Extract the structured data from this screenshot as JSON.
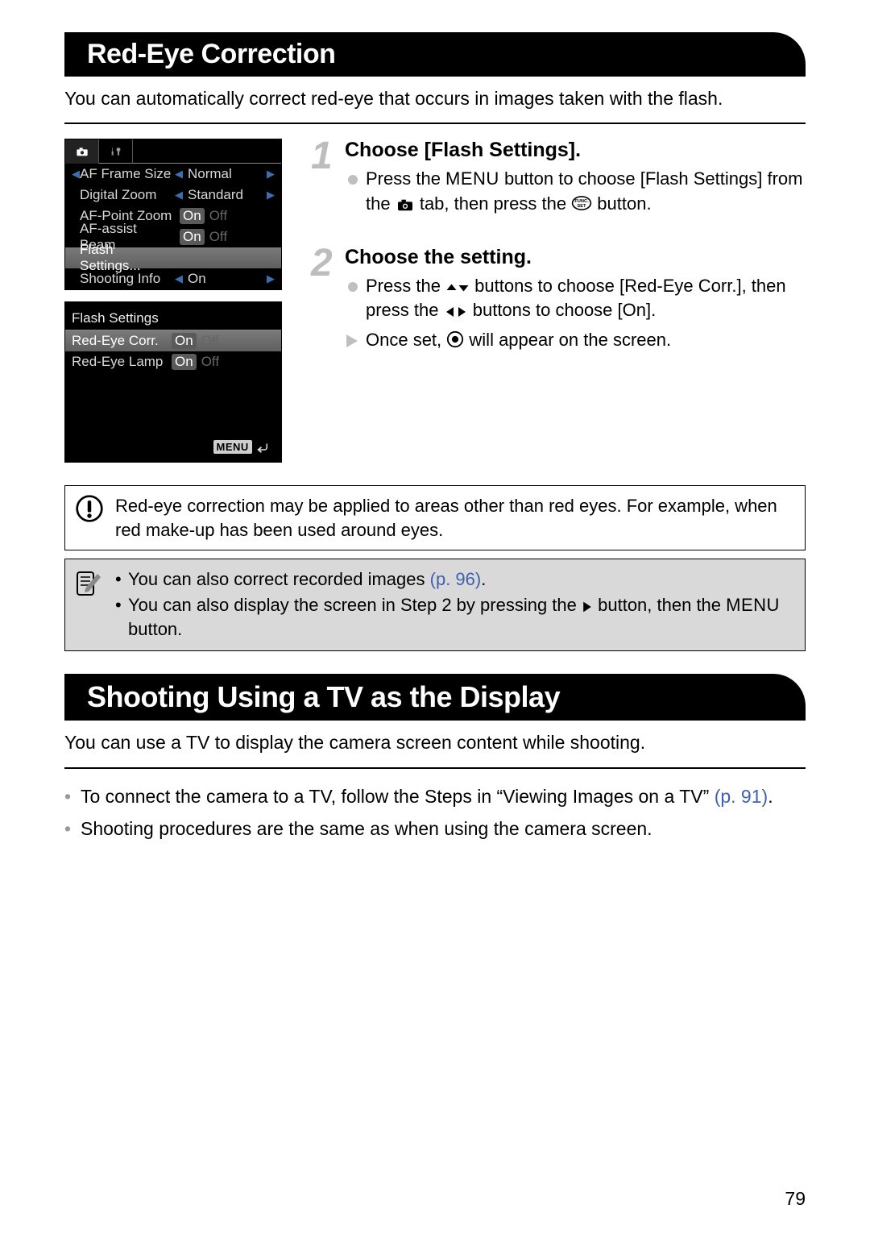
{
  "section1": {
    "title": "Red-Eye Correction",
    "intro": "You can automatically correct red-eye that occurs in images taken with the flash.",
    "lcd_menu": {
      "rows": [
        {
          "label": "AF Frame Size",
          "value": "Normal",
          "arrows": true
        },
        {
          "label": "Digital Zoom",
          "value": "Standard",
          "arrows": true
        },
        {
          "label": "AF-Point Zoom",
          "on": "On",
          "off": "Off"
        },
        {
          "label": "AF-assist Beam",
          "on": "On",
          "off": "Off"
        },
        {
          "label": "Flash Settings...",
          "selected": true
        },
        {
          "label": "Shooting Info",
          "value": "On",
          "arrows": true
        }
      ]
    },
    "lcd_flash": {
      "title": "Flash Settings",
      "rows": [
        {
          "label": "Red-Eye Corr.",
          "on": "On",
          "off": "Off",
          "selected": true
        },
        {
          "label": "Red-Eye Lamp",
          "on": "On",
          "off": "Off"
        }
      ],
      "menu_label": "MENU"
    },
    "step1": {
      "title": "Choose [Flash Settings].",
      "body_a": "Press the ",
      "menu_word": "MENU",
      "body_b": " button to choose [Flash Settings] from the ",
      "body_c": " tab, then press the ",
      "body_d": " button."
    },
    "step2": {
      "title": "Choose the setting.",
      "line1a": "Press the ",
      "line1b": " buttons to choose [Red-Eye Corr.], then press the ",
      "line1c": " buttons to choose [On].",
      "line2a": "Once set, ",
      "line2b": " will appear on the screen."
    },
    "warning": "Red-eye correction may be applied to areas other than red eyes. For example, when red make-up has been used around eyes.",
    "note_items": {
      "i1a": "You can also correct recorded images ",
      "i1link": "(p. 96)",
      "i1b": ".",
      "i2a": "You can also display the screen in Step 2 by pressing the ",
      "i2b": " button, then the ",
      "i2menu": "MENU",
      "i2c": " button."
    }
  },
  "section2": {
    "title": "Shooting Using a TV as the Display",
    "intro": "You can use a TV to display the camera screen content while shooting.",
    "b1a": "To connect the camera to a TV, follow the Steps in “Viewing Images on a TV” ",
    "b1link": "(p. 91)",
    "b1b": ".",
    "b2": "Shooting procedures are the same as when using the camera screen."
  },
  "page_number": "79"
}
